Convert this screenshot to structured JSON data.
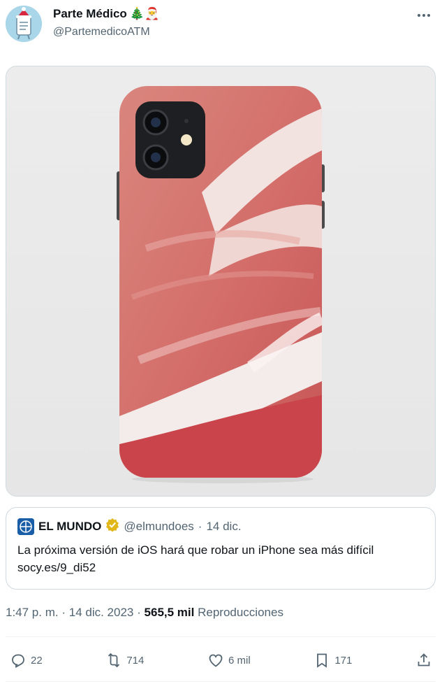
{
  "author": {
    "name": "Parte Médico",
    "name_emoji": "🎄🎅",
    "handle": "@PartemedicoATM"
  },
  "quote": {
    "name": "EL MUNDO",
    "handle": "@elmundoes",
    "separator": "·",
    "date": "14 dic.",
    "text": "La próxima versión de iOS hará que robar un iPhone sea más difícil socy.es/9_di52"
  },
  "meta": {
    "time": "1:47 p. m.",
    "sep1": "·",
    "date": "14 dic. 2023",
    "sep2": "·",
    "views_count": "565,5 mil",
    "views_label": "Reproducciones"
  },
  "actions": {
    "replies": "22",
    "reposts": "714",
    "likes": "6 mil",
    "bookmarks": "171"
  },
  "colors": {
    "text": "#0f1419",
    "secondary": "#536471",
    "border": "#cfd9de",
    "verified_gold": "#e2b719"
  }
}
